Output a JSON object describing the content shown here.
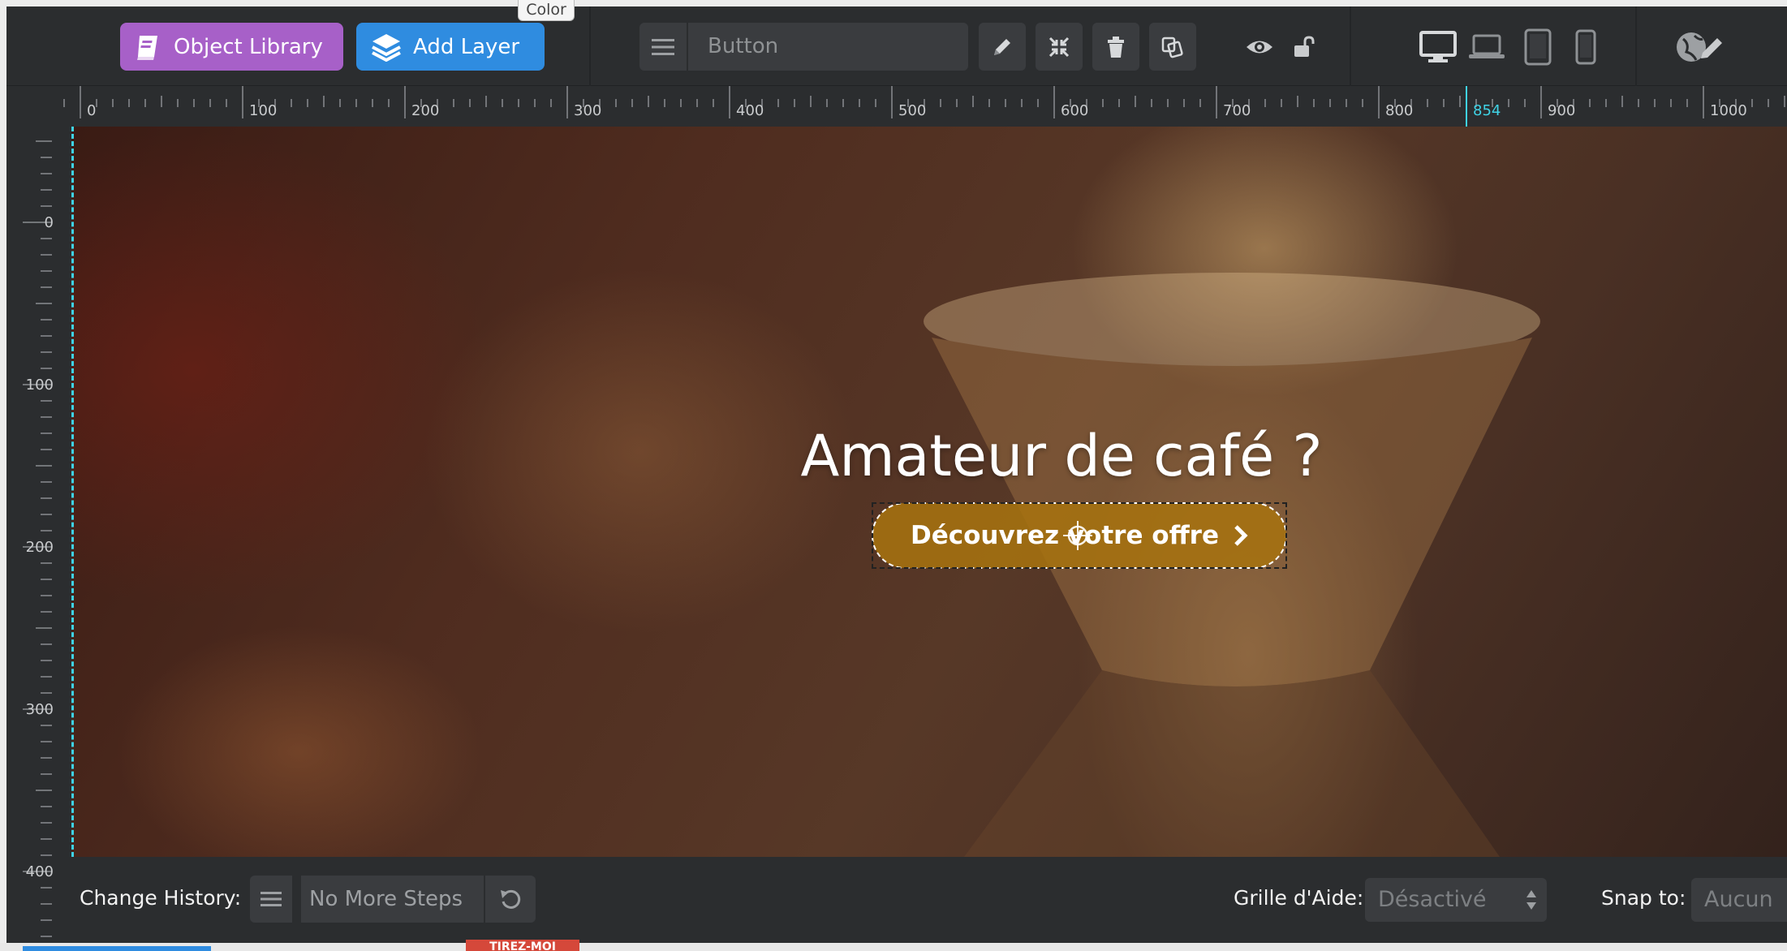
{
  "toolbar": {
    "object_library_label": "Object Library",
    "add_layer_label": "Add Layer",
    "color_tab_label": "Color",
    "layer_name_value": "Button",
    "icons": [
      "menu-icon",
      "pencil-icon",
      "compress-icon",
      "trash-icon",
      "duplicate-icon",
      "eye-icon",
      "unlock-icon",
      "desktop-icon",
      "laptop-icon",
      "tablet-icon",
      "phone-icon",
      "globe-edit-icon"
    ]
  },
  "ruler_top": {
    "labels": [
      "0",
      "100",
      "200",
      "300",
      "400",
      "500",
      "600",
      "700",
      "800",
      "854",
      "900",
      "1000"
    ],
    "marker_value": "854",
    "marker_color": "#3fd3e6"
  },
  "ruler_left": {
    "labels": [
      "0",
      "100",
      "200",
      "300",
      "400"
    ]
  },
  "canvas": {
    "hero_title": "Amateur de café ?",
    "cta_label": "Découvrez votre offre",
    "cta_color": "#a67210",
    "guide_color": "#3fd3e6"
  },
  "bottom_bar": {
    "history_label": "Change History:",
    "history_value": "No More Steps",
    "grid_label": "Grille d'Aide:",
    "grid_value": "Désactivé",
    "snap_label": "Snap to:",
    "snap_value": "Aucun"
  },
  "bottom_strip": {
    "tab_label": "TIREZ-MOI"
  },
  "colors": {
    "toolbar_bg": "#2b2d2f",
    "object_library": "#a760c8",
    "add_layer": "#2f8ce0"
  }
}
